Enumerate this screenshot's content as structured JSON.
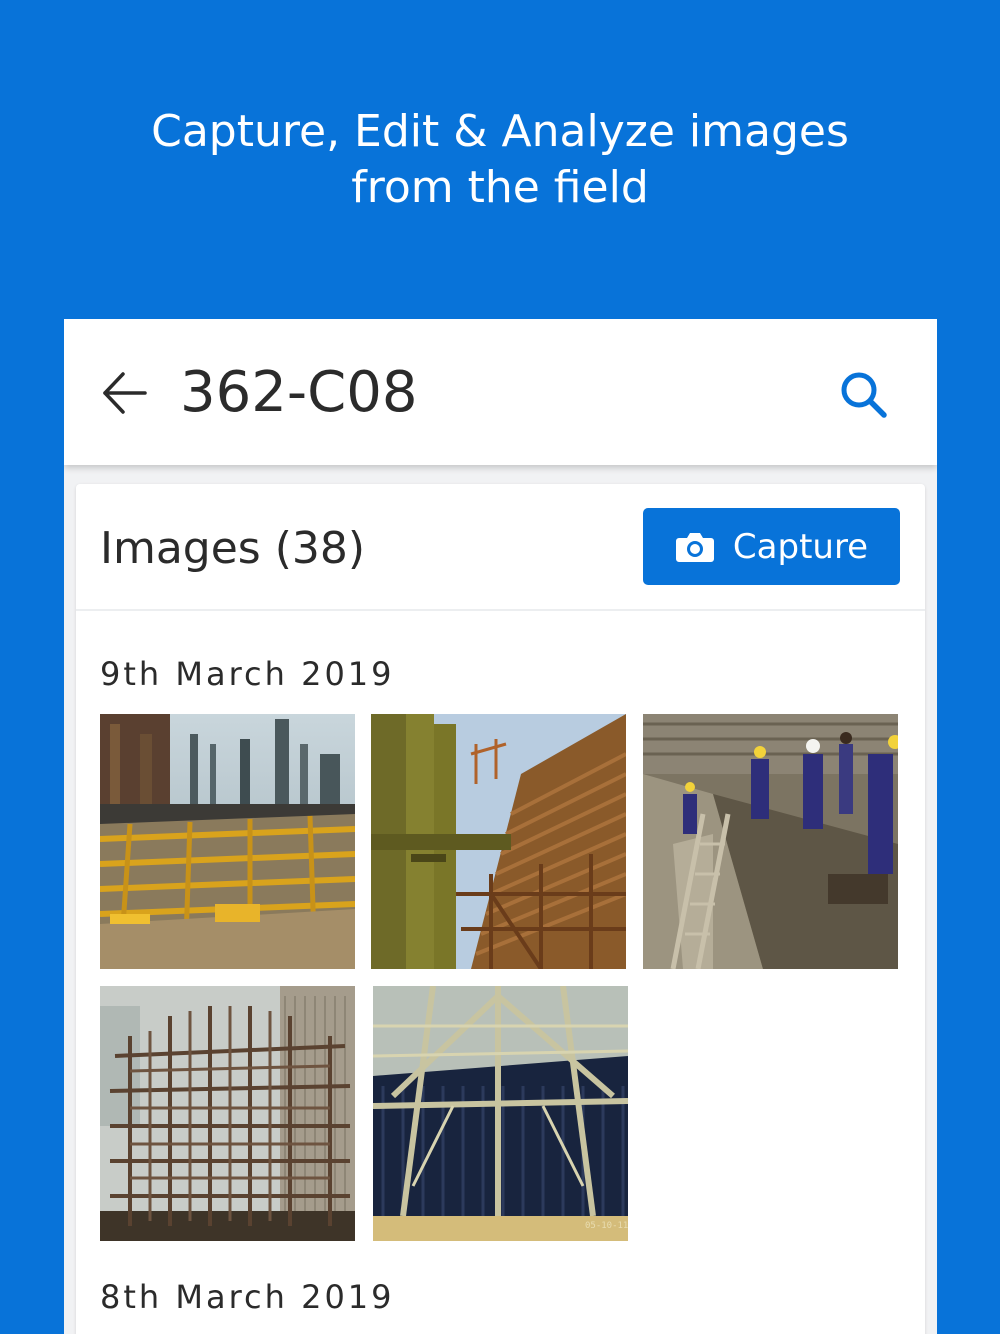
{
  "headline": {
    "line1": "Capture, Edit & Analyze images",
    "line2": "from the field"
  },
  "appbar": {
    "back_icon": "arrow-left-icon",
    "title": "362-C08",
    "search_icon": "search-icon"
  },
  "images_card": {
    "title": "Images (38)",
    "capture_button": {
      "icon": "camera-icon",
      "label": "Capture"
    },
    "groups": [
      {
        "date": "9th March 2019",
        "photos": [
          {
            "subject": "refinery-deck-structure-photo"
          },
          {
            "subject": "pipes-and-louvers-photo"
          },
          {
            "subject": "workers-at-basin-photo",
            "stamp": ""
          },
          {
            "subject": "timber-scaffold-frame-photo"
          },
          {
            "subject": "timber-truss-over-fill-photo",
            "stamp": "05-10-11"
          }
        ]
      },
      {
        "date": "8th March 2019",
        "photos": []
      }
    ]
  },
  "colors": {
    "brand_blue": "#0873d9",
    "text_dark": "#2b2b2b",
    "surface": "#ffffff",
    "background": "#f1f2f4"
  }
}
